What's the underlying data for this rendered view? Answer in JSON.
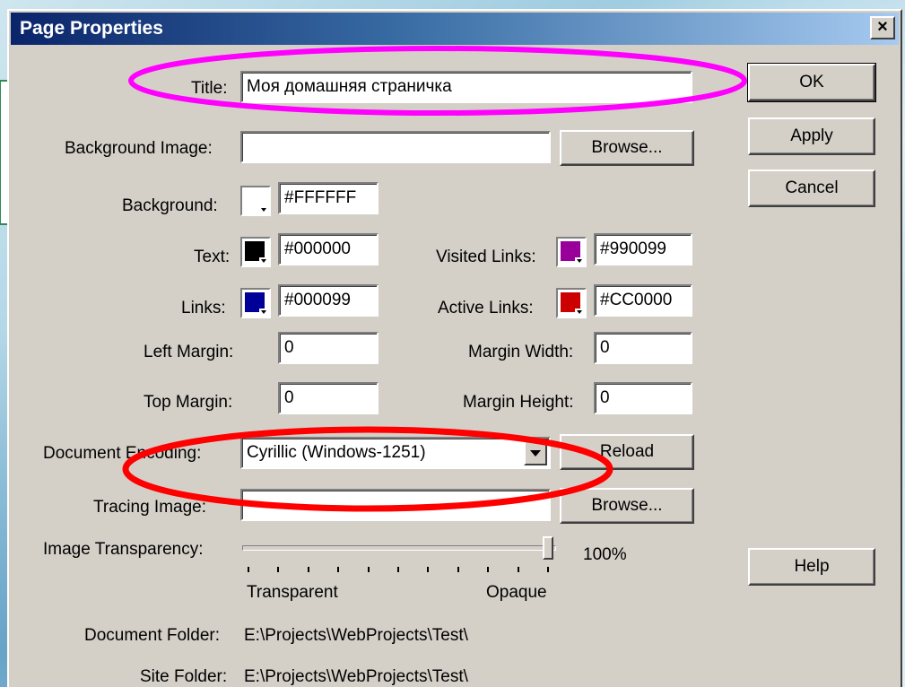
{
  "window": {
    "title": "Page Properties",
    "close_label": "×"
  },
  "fields": {
    "title_label": "Title:",
    "title_value": "Моя домашняя страничка",
    "bg_image_label": "Background Image:",
    "bg_image_value": "",
    "background_label": "Background:",
    "background_value": "#FFFFFF",
    "text_label": "Text:",
    "text_value": "#000000",
    "visited_label": "Visited Links:",
    "visited_value": "#990099",
    "links_label": "Links:",
    "links_value": "#000099",
    "active_label": "Active Links:",
    "active_value": "#CC0000",
    "left_margin_label": "Left Margin:",
    "left_margin_value": "0",
    "margin_width_label": "Margin Width:",
    "margin_width_value": "0",
    "top_margin_label": "Top Margin:",
    "top_margin_value": "0",
    "margin_height_label": "Margin Height:",
    "margin_height_value": "0",
    "encoding_label": "Document Encoding:",
    "encoding_value": "Cyrillic (Windows-1251)",
    "tracing_label": "Tracing Image:",
    "tracing_value": "",
    "transparency_label": "Image Transparency:",
    "transparency_value": "100%",
    "transparency_level": 100,
    "transparent_label": "Transparent",
    "opaque_label": "Opaque",
    "doc_folder_label": "Document Folder:",
    "doc_folder_value": "E:\\Projects\\WebProjects\\Test\\",
    "site_folder_label": "Site Folder:",
    "site_folder_value": "E:\\Projects\\WebProjects\\Test\\"
  },
  "buttons": {
    "ok": "OK",
    "apply": "Apply",
    "cancel": "Cancel",
    "browse1": "Browse...",
    "reload": "Reload",
    "browse2": "Browse...",
    "help": "Help"
  },
  "colors": {
    "background_swatch": "#FFFFFF",
    "text_swatch": "#000000",
    "visited_swatch": "#990099",
    "links_swatch": "#000099",
    "active_swatch": "#CC0000",
    "highlight_title": "#ff00ff",
    "highlight_encoding": "#ff0000",
    "callout_border": "#2e8b57"
  }
}
